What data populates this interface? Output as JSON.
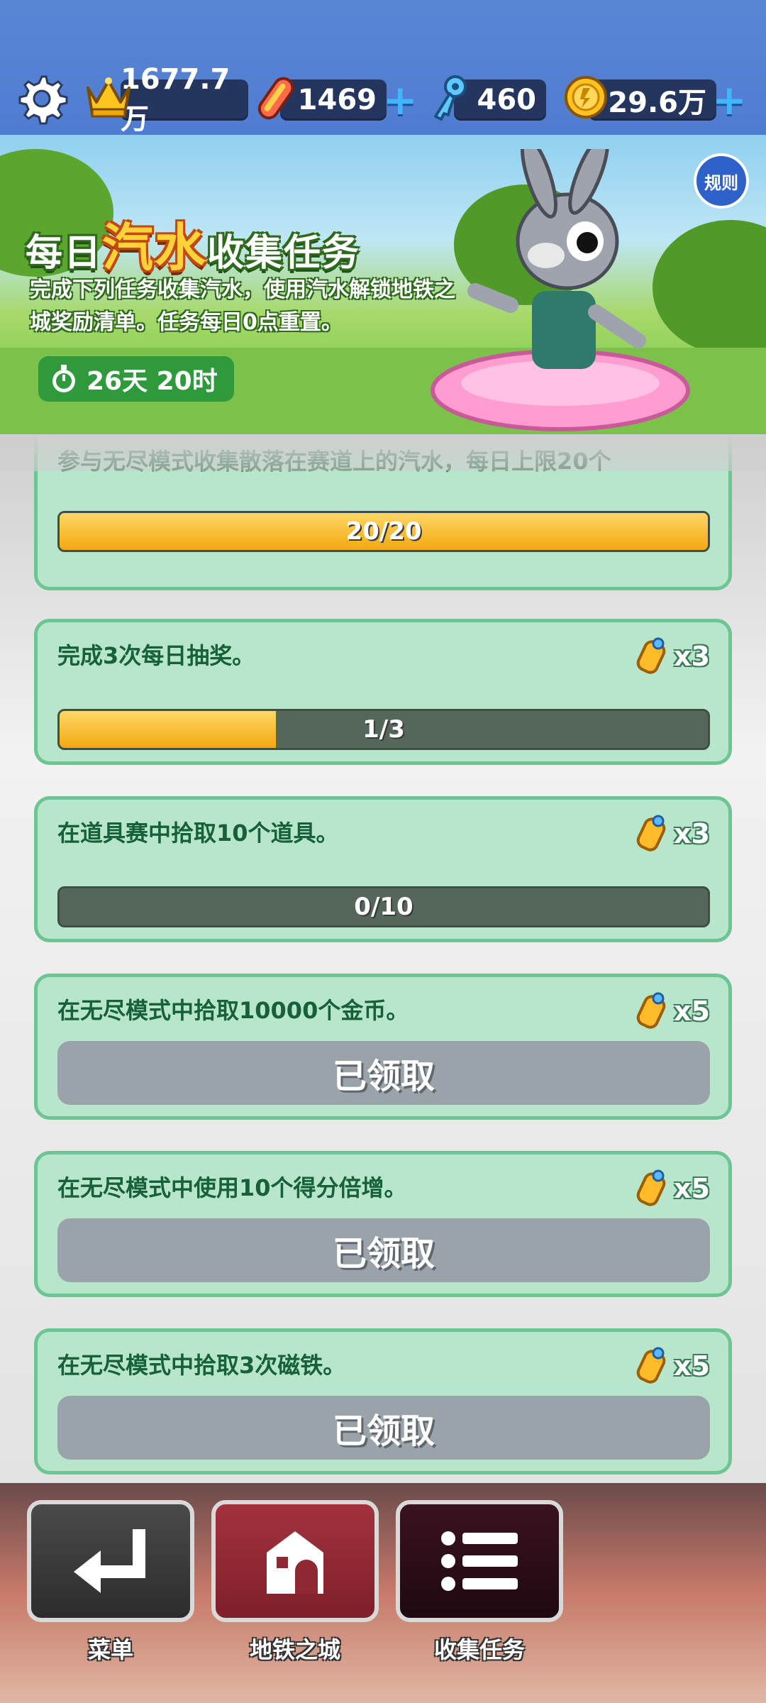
{
  "currencies": {
    "crowns": "1677.7万",
    "hoverboards": "1469",
    "keys": "460",
    "coins": "29.6万",
    "plus": "+"
  },
  "banner": {
    "title_part1": "每日",
    "title_highlight": "汽水",
    "title_part2": "收集任务",
    "description": "完成下列任务收集汽水，使用汽水解锁地铁之城奖励清单。任务每日0点重置。",
    "timer": "26天 20时",
    "rules_label": "规则"
  },
  "tasks": [
    {
      "text": "参与无尽模式收集散落在赛道上的汽水，每日上限20个",
      "progress": 20,
      "goal": 20,
      "progress_text": "20/20"
    },
    {
      "text": "完成3次每日抽奖。",
      "reward": "x3",
      "progress": 1,
      "goal": 3,
      "progress_text": "1/3"
    },
    {
      "text": "在道具赛中拾取10个道具。",
      "reward": "x3",
      "progress": 0,
      "goal": 10,
      "progress_text": "0/10"
    },
    {
      "text": "在无尽模式中拾取10000个金币。",
      "reward": "x5",
      "status": "已领取"
    },
    {
      "text": "在无尽模式中使用10个得分倍增。",
      "reward": "x5",
      "status": "已领取"
    },
    {
      "text": "在无尽模式中拾取3次磁铁。",
      "reward": "x5",
      "status": "已领取"
    }
  ],
  "nav": {
    "menu": "菜单",
    "subway_city": "地铁之城",
    "collect_tasks": "收集任务"
  },
  "colors": {
    "card_bg": "#b7e6cb",
    "card_border": "#6dc594",
    "task_text": "#16603a",
    "progress_fill": "#f3a90f",
    "claimed_bg": "#9ba3aa"
  }
}
